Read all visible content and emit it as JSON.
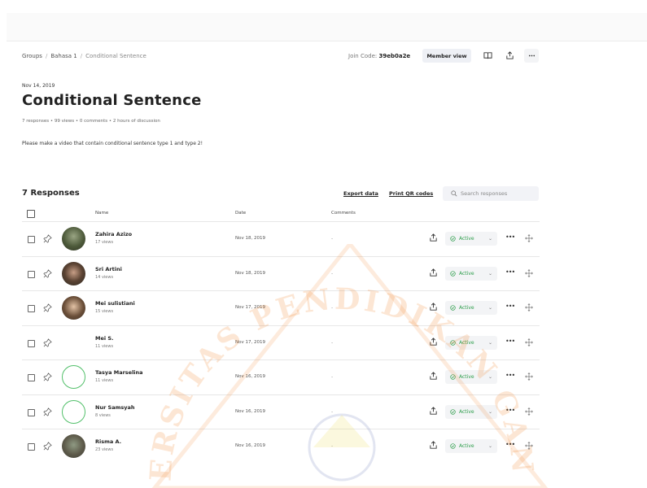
{
  "breadcrumb": [
    "Groups",
    "Bahasa 1",
    "Conditional Sentence"
  ],
  "join": {
    "label": "Join Code:",
    "code": "39eb0a2e"
  },
  "header_buttons": {
    "member_view": "Member view"
  },
  "page": {
    "date": "Nov 14, 2019",
    "title": "Conditional Sentence",
    "meta": "7 responses • 99 views • 0 comments • 2 hours of discussion",
    "description": "Please make a video that contain conditional sentence type 1 and type 2!"
  },
  "responses": {
    "heading": "7 Responses",
    "export": "Export data",
    "qr": "Print QR codes",
    "search_placeholder": "Search responses",
    "columns": {
      "name": "Name",
      "date": "Date",
      "comments": "Comments"
    },
    "rows": [
      {
        "name": "Zahira Azizo",
        "views": "17 views",
        "date": "Nov 18, 2019",
        "comments": "-",
        "status": "Active"
      },
      {
        "name": "Sri Artini",
        "views": "14 views",
        "date": "Nov 18, 2019",
        "comments": "-",
        "status": "Active"
      },
      {
        "name": "Mei sulistiani",
        "views": "15 views",
        "date": "Nov 17, 2019",
        "comments": "-",
        "status": "Active"
      },
      {
        "name": "Mei S.",
        "views": "11 views",
        "date": "Nov 17, 2019",
        "comments": "-",
        "status": "Active"
      },
      {
        "name": "Tasya Marselina",
        "views": "11 views",
        "date": "Nov 16, 2019",
        "comments": "-",
        "status": "Active"
      },
      {
        "name": "Nur Samsyah",
        "views": "8 views",
        "date": "Nov 16, 2019",
        "comments": "-",
        "status": "Active"
      },
      {
        "name": "Risma A.",
        "views": "23 views",
        "date": "Nov 16, 2019",
        "comments": "-",
        "status": "Active"
      }
    ]
  },
  "watermark_text": "UNIVERSITAS PENDIDIKAN GANESHA",
  "colors": {
    "active": "#2c9d4a",
    "ring": "#53c06b",
    "watermark": "#f07a1a"
  }
}
